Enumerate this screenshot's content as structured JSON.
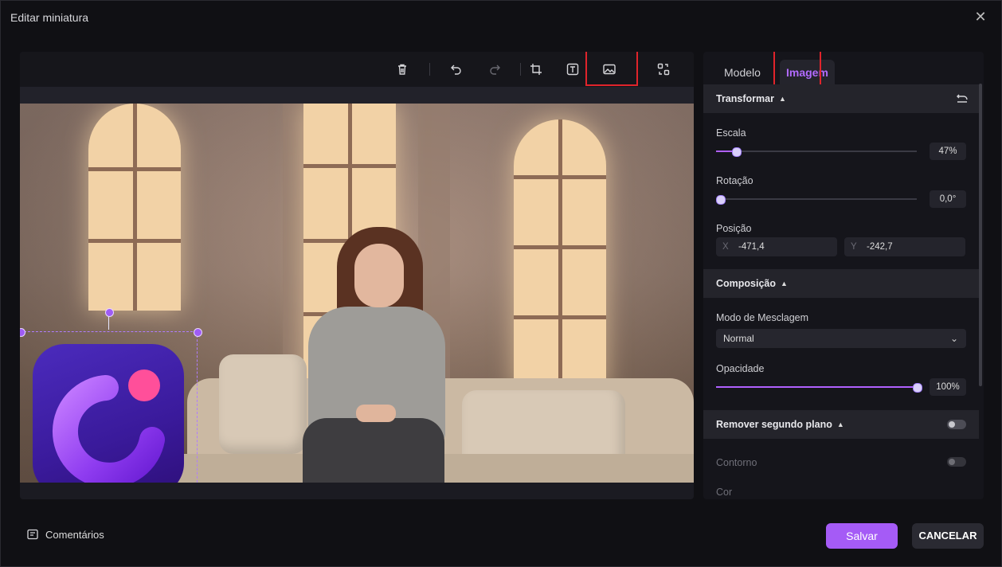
{
  "window": {
    "title": "Editar miniatura"
  },
  "tabs": {
    "modelo": "Modelo",
    "imagem": "Imagem"
  },
  "transform": {
    "header": "Transformar",
    "scale_label": "Escala",
    "scale_value": "47%",
    "scale_fraction": 0.1,
    "rotation_label": "Rotação",
    "rotation_value": "0,0°",
    "rotation_fraction": 0,
    "position_label": "Posição",
    "x_axis": "X",
    "x_value": "-471,4",
    "y_axis": "Y",
    "y_value": "-242,7"
  },
  "composition": {
    "header": "Composição",
    "blend_label": "Modo de Mesclagem",
    "blend_value": "Normal",
    "opacity_label": "Opacidade",
    "opacity_value": "100%",
    "opacity_fraction": 1.0
  },
  "remove_bg": {
    "header": "Remover segundo plano",
    "enabled": false,
    "contour_label": "Contorno",
    "contour_enabled": false,
    "color_label": "Cor"
  },
  "footer": {
    "comments_label": "Comentários",
    "save_label": "Salvar",
    "cancel_label": "CANCELAR"
  },
  "colors": {
    "accent": "#a55bf6",
    "highlight": "#e0242b"
  }
}
